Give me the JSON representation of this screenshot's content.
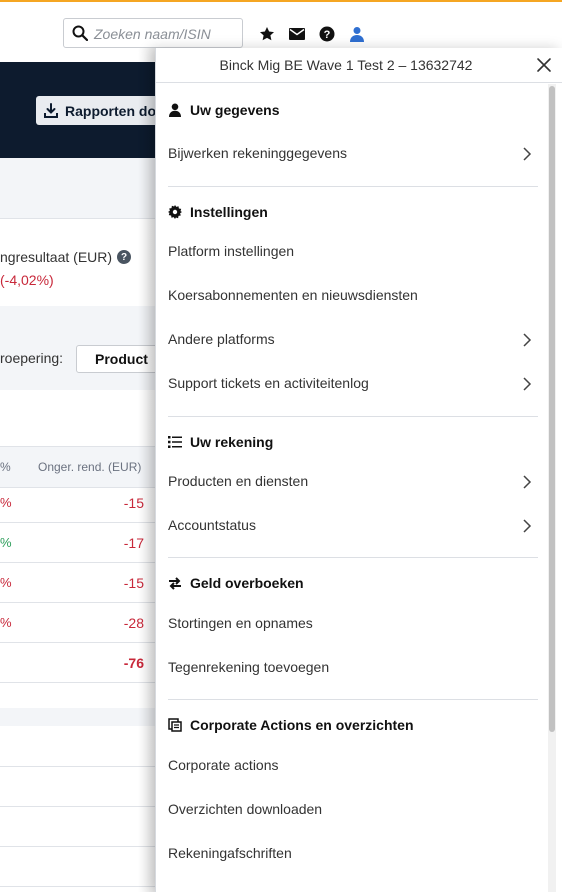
{
  "search": {
    "placeholder": "Zoeken naam/ISIN"
  },
  "top_icons": [
    "star-icon",
    "mail-icon",
    "help-icon",
    "user-icon"
  ],
  "hero": {
    "report_button_label": "Rapporten do"
  },
  "background": {
    "result_label": "ngresultaat (EUR)",
    "result_help": "?",
    "result_value": "(-4,02%)",
    "grouping_label": "roepering:",
    "grouping_value": "Product",
    "table_header_pct": "%",
    "table_header_col": "Onger. rend. (EUR)",
    "rows": [
      {
        "pct": "%",
        "pct_color": "#c8283a",
        "value": "-15"
      },
      {
        "pct": "%",
        "pct_color": "#2e9e5b",
        "value": "-17"
      },
      {
        "pct": "%",
        "pct_color": "#c8283a",
        "value": "-15"
      },
      {
        "pct": "%",
        "pct_color": "#c8283a",
        "value": "-28"
      }
    ],
    "total": "-76"
  },
  "panel": {
    "title": "Binck Mig BE Wave 1 Test 2 – 13632742",
    "sections": [
      {
        "heading": "Uw gegevens",
        "icon": "person-icon",
        "items": [
          {
            "label": "Bijwerken rekeninggegevens",
            "chevron": true
          }
        ]
      },
      {
        "heading": "Instellingen",
        "icon": "gear-icon",
        "items": [
          {
            "label": "Platform instellingen",
            "chevron": false
          },
          {
            "label": "Koersabonnementen en nieuwsdiensten",
            "chevron": false
          },
          {
            "label": "Andere platforms",
            "chevron": true
          },
          {
            "label": "Support tickets en activiteitenlog",
            "chevron": true
          }
        ]
      },
      {
        "heading": "Uw rekening",
        "icon": "list-icon",
        "items": [
          {
            "label": "Producten en diensten",
            "chevron": true
          },
          {
            "label": "Accountstatus",
            "chevron": true
          }
        ]
      },
      {
        "heading": "Geld overboeken",
        "icon": "transfer-icon",
        "items": [
          {
            "label": "Stortingen en opnames",
            "chevron": false
          },
          {
            "label": "Tegenrekening toevoegen",
            "chevron": false
          }
        ]
      },
      {
        "heading": "Corporate Actions en overzichten",
        "icon": "documents-icon",
        "items": [
          {
            "label": "Corporate actions",
            "chevron": false
          },
          {
            "label": "Overzichten downloaden",
            "chevron": false
          },
          {
            "label": "Rekeningafschriften",
            "chevron": false
          }
        ]
      }
    ]
  },
  "colors": {
    "accent_top": "#f5a623",
    "hero": "#0d1b2e",
    "negative": "#c8283a",
    "positive": "#2e9e5b",
    "user_icon": "#2f6fd1"
  }
}
